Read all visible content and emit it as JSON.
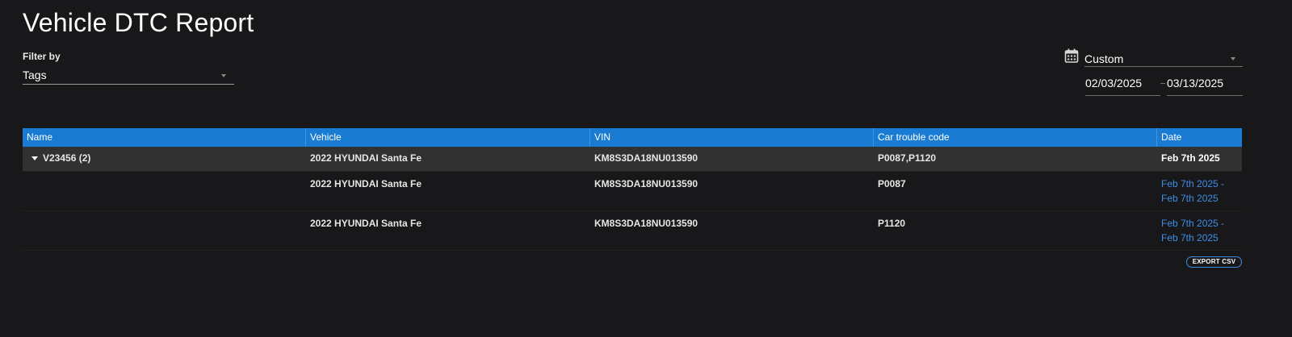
{
  "page": {
    "title": "Vehicle DTC Report"
  },
  "filter": {
    "label": "Filter by",
    "value": "Tags"
  },
  "date_range": {
    "preset": "Custom",
    "start": "02/03/2025",
    "end": "03/13/2025"
  },
  "table": {
    "columns": [
      "Name",
      "Vehicle",
      "VIN",
      "Car trouble code",
      "Date"
    ],
    "group": {
      "name": "V23456 (2)",
      "vehicle": "2022 HYUNDAI Santa Fe",
      "vin": "KM8S3DA18NU013590",
      "code": "P0087,P1120",
      "date": "Feb 7th 2025"
    },
    "rows": [
      {
        "vehicle": "2022 HYUNDAI Santa Fe",
        "vin": "KM8S3DA18NU013590",
        "code": "P0087",
        "date_line1": "Feb 7th 2025 -",
        "date_line2": "Feb 7th 2025"
      },
      {
        "vehicle": "2022 HYUNDAI Santa Fe",
        "vin": "KM8S3DA18NU013590",
        "code": "P1120",
        "date_line1": "Feb 7th 2025 -",
        "date_line2": "Feb 7th 2025"
      }
    ]
  },
  "actions": {
    "export_label": "EXPORT CSV"
  },
  "colors": {
    "background": "#18181b",
    "header": "#1a7bd2",
    "group_row": "#313131",
    "link": "#3f8ee6"
  },
  "icons": {
    "calendar": "calendar-icon",
    "dropdown": "caret-down-icon",
    "expand": "expand-caret-icon"
  }
}
